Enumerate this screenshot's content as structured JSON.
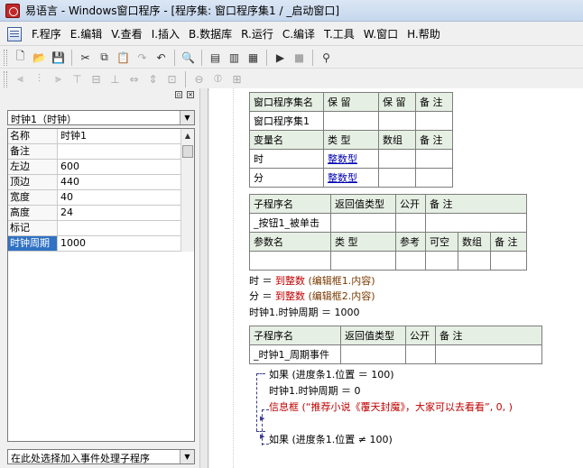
{
  "window": {
    "title": "易语言 - Windows窗口程序 - [程序集: 窗口程序集1 / _启动窗口]"
  },
  "menu": [
    "F.程序",
    "E.编辑",
    "V.查看",
    "I.插入",
    "B.数据库",
    "R.运行",
    "C.编译",
    "T.工具",
    "W.窗口",
    "H.帮助"
  ],
  "properties": {
    "object_selected": "时钟1（时钟）",
    "rows": [
      {
        "name": "名称",
        "value": "时钟1"
      },
      {
        "name": "备注",
        "value": ""
      },
      {
        "name": "左边",
        "value": "600"
      },
      {
        "name": "顶边",
        "value": "440"
      },
      {
        "name": "宽度",
        "value": "40"
      },
      {
        "name": "高度",
        "value": "24"
      },
      {
        "name": "标记",
        "value": ""
      },
      {
        "name": "时钟周期",
        "value": "1000"
      }
    ],
    "event_selector": "在此处选择加入事件处理子程序"
  },
  "editor": {
    "assembly_table": {
      "headers": [
        "窗口程序集名",
        "保 留",
        "保 留",
        "备 注"
      ],
      "name": "窗口程序集1",
      "var_headers": [
        "变量名",
        "类 型",
        "数组",
        "备 注"
      ],
      "vars": [
        {
          "name": "时",
          "type": "整数型"
        },
        {
          "name": "分",
          "type": "整数型"
        }
      ]
    },
    "sub1": {
      "headers": [
        "子程序名",
        "返回值类型",
        "公开",
        "备 注"
      ],
      "name": "_按钮1_被单击",
      "param_headers": [
        "参数名",
        "类 型",
        "参考",
        "可空",
        "数组",
        "备 注"
      ]
    },
    "code1": [
      {
        "lhs": "时 ＝ ",
        "fn": "到整数",
        "arg": "(编辑框1.内容)"
      },
      {
        "lhs": "分 ＝ ",
        "fn": "到整数",
        "arg": "(编辑框2.内容)"
      },
      {
        "lhs": "时钟1.时钟周期 ＝ 1000",
        "fn": "",
        "arg": ""
      }
    ],
    "sub2": {
      "headers": [
        "子程序名",
        "返回值类型",
        "公开",
        "备 注"
      ],
      "name": "_时钟1_周期事件"
    },
    "code2": {
      "if1": "如果 (进度条1.位置 ＝ 100)",
      "line2": "时钟1.时钟周期 ＝ 0",
      "msg_fn": "信息框",
      "msg_args": "(“推荐小说《覆天封魔》，大家可以去看看”, 0, )",
      "if2": "如果 (进度条1.位置 ≠ 100)"
    }
  }
}
